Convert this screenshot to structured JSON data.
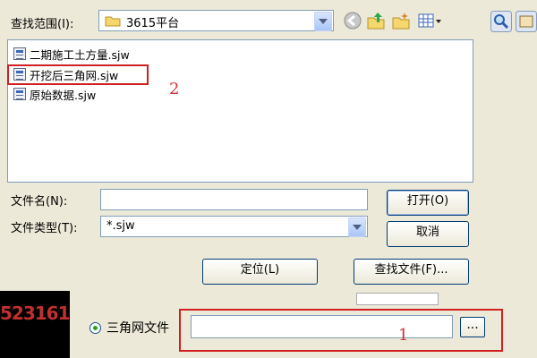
{
  "dialog": {
    "look_in_label": "查找范围(I):",
    "look_in_value": "3615平台",
    "files": [
      {
        "name": "二期施工土方量.sjw"
      },
      {
        "name": "开挖后三角网.sjw"
      },
      {
        "name": "原始数据.sjw"
      }
    ],
    "filename_label": "文件名(N):",
    "filename_value": "",
    "filetype_label": "文件类型(T):",
    "filetype_value": "*.sjw",
    "open_button": "打开(O)",
    "cancel_button": "取消",
    "locate_button": "定位(L)",
    "find_button": "查找文件(F)..."
  },
  "annotations": {
    "step1": "1",
    "step2": "2"
  },
  "background_dialog": {
    "tin_file_label": "三角网文件",
    "tin_file_value": "",
    "browse_button": "...",
    "cad_text": "523161"
  },
  "colors": {
    "highlight_red": "#d02020",
    "window_bg": "#ECE9D8",
    "border_blue": "#7F9DB9"
  }
}
